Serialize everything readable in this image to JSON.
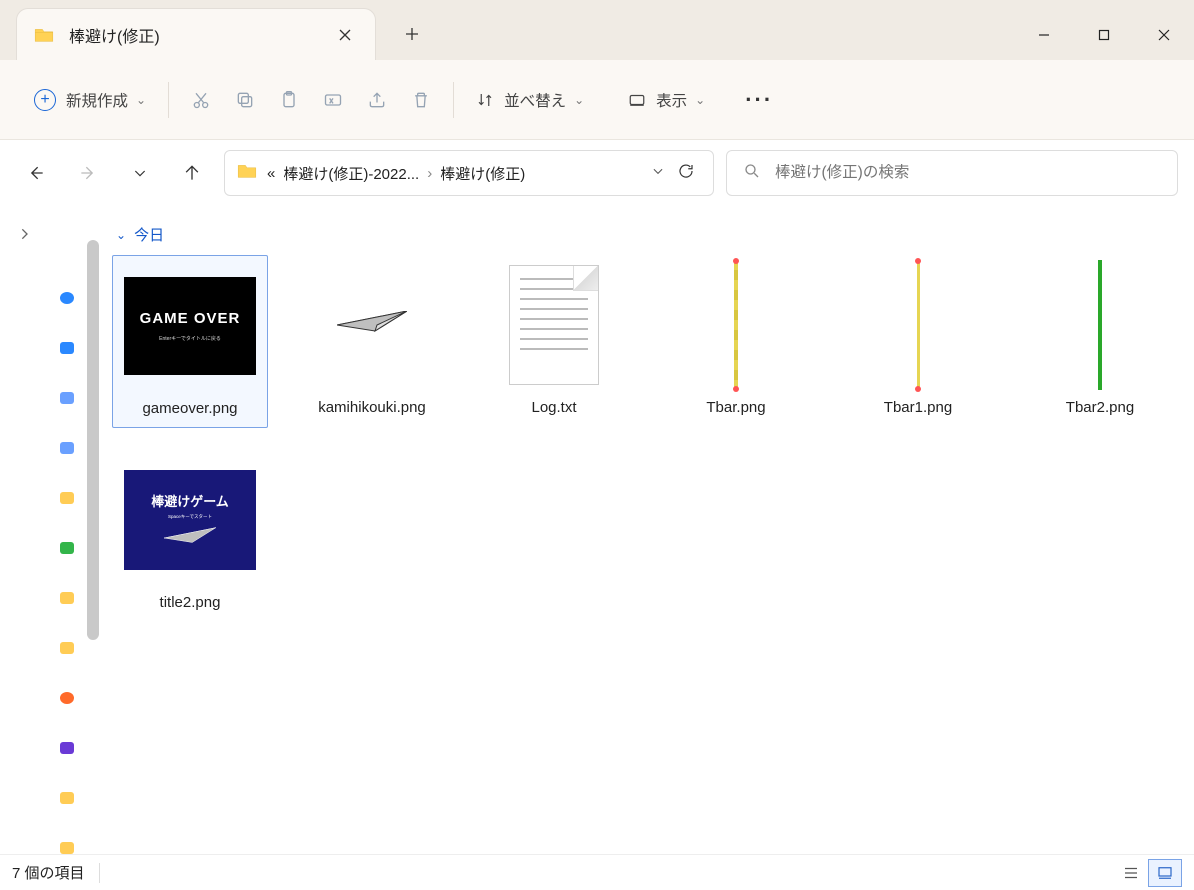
{
  "tab": {
    "title": "棒避け(修正)"
  },
  "toolbar": {
    "new_label": "新規作成",
    "sort_label": "並べ替え",
    "view_label": "表示"
  },
  "breadcrumb": {
    "prefix": "«",
    "seg1": "棒避け(修正)-2022...",
    "seg2": "棒避け(修正)"
  },
  "search": {
    "placeholder": "棒避け(修正)の検索"
  },
  "group": {
    "today": "今日"
  },
  "files": {
    "gameover": {
      "name": "gameover.png",
      "thumb_text": "GAME OVER",
      "thumb_sub": "Enterキーでタイトルに戻る"
    },
    "kamihikouki": {
      "name": "kamihikouki.png"
    },
    "log": {
      "name": "Log.txt"
    },
    "tbar": {
      "name": "Tbar.png"
    },
    "tbar1": {
      "name": "Tbar1.png"
    },
    "tbar2": {
      "name": "Tbar2.png"
    },
    "title2": {
      "name": "title2.png",
      "thumb_text": "棒避けゲーム",
      "thumb_sub": "Spaceキーでスタート"
    }
  },
  "status": {
    "count": "7 個の項目"
  }
}
